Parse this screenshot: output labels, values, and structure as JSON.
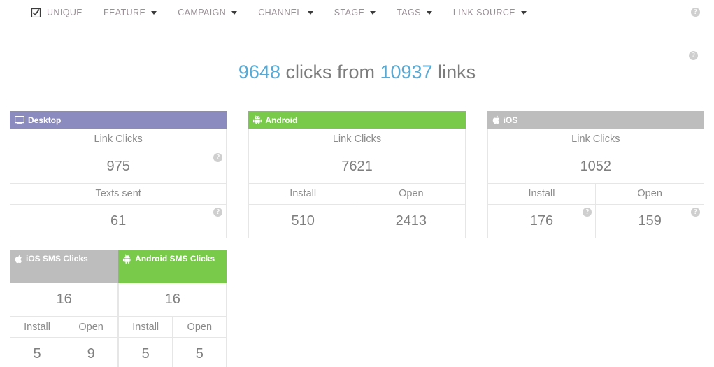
{
  "nav": {
    "items": [
      {
        "label": "UNIQUE",
        "icon": "checked-checkbox-icon",
        "caret": false
      },
      {
        "label": "FEATURE",
        "icon": null,
        "caret": true
      },
      {
        "label": "CAMPAIGN",
        "icon": null,
        "caret": true
      },
      {
        "label": "CHANNEL",
        "icon": null,
        "caret": true
      },
      {
        "label": "STAGE",
        "icon": null,
        "caret": true
      },
      {
        "label": "TAGS",
        "icon": null,
        "caret": true
      },
      {
        "label": "LINK SOURCE",
        "icon": null,
        "caret": true
      }
    ],
    "help_icon": "help-icon"
  },
  "banner": {
    "clicks": "9648",
    "mid_text": " clicks from ",
    "links": "10937",
    "end_text": " links",
    "help_icon": "help-icon"
  },
  "cards": {
    "desktop": {
      "title": "Desktop",
      "icon": "desktop-monitor-icon",
      "header_color": "#8b8bc0",
      "rows": [
        {
          "label": "Link Clicks",
          "value": "975",
          "help": true
        },
        {
          "label": "Texts sent",
          "value": "61",
          "help": true
        }
      ],
      "sms": [
        {
          "title": "iOS SMS Clicks",
          "icon": "apple-logo-icon",
          "header_color": "#bdbdbd",
          "total": "16",
          "cols": [
            {
              "label": "Install",
              "value": "5"
            },
            {
              "label": "Open",
              "value": "9"
            }
          ]
        },
        {
          "title": "Android SMS Clicks",
          "icon": "android-robot-icon",
          "header_color": "#79c94a",
          "total": "16",
          "cols": [
            {
              "label": "Install",
              "value": "5"
            },
            {
              "label": "Open",
              "value": "5"
            }
          ]
        }
      ]
    },
    "android": {
      "title": "Android",
      "icon": "android-robot-icon",
      "header_color": "#79c94a",
      "link_clicks_label": "Link Clicks",
      "link_clicks_value": "7621",
      "cols": [
        {
          "label": "Install",
          "value": "510",
          "help": false
        },
        {
          "label": "Open",
          "value": "2413",
          "help": false
        }
      ]
    },
    "ios": {
      "title": "iOS",
      "icon": "apple-logo-icon",
      "header_color": "#bdbdbd",
      "link_clicks_label": "Link Clicks",
      "link_clicks_value": "1052",
      "cols": [
        {
          "label": "Install",
          "value": "176",
          "help": true
        },
        {
          "label": "Open",
          "value": "159",
          "help": true
        }
      ]
    }
  },
  "colors": {
    "accent_blue": "#58a9d4",
    "purple": "#8b8bc0",
    "green": "#79c94a",
    "gray": "#bdbdbd",
    "text_gray": "#8b8b8b",
    "nav_text": "#9b8e96"
  },
  "help_glyph": "?"
}
